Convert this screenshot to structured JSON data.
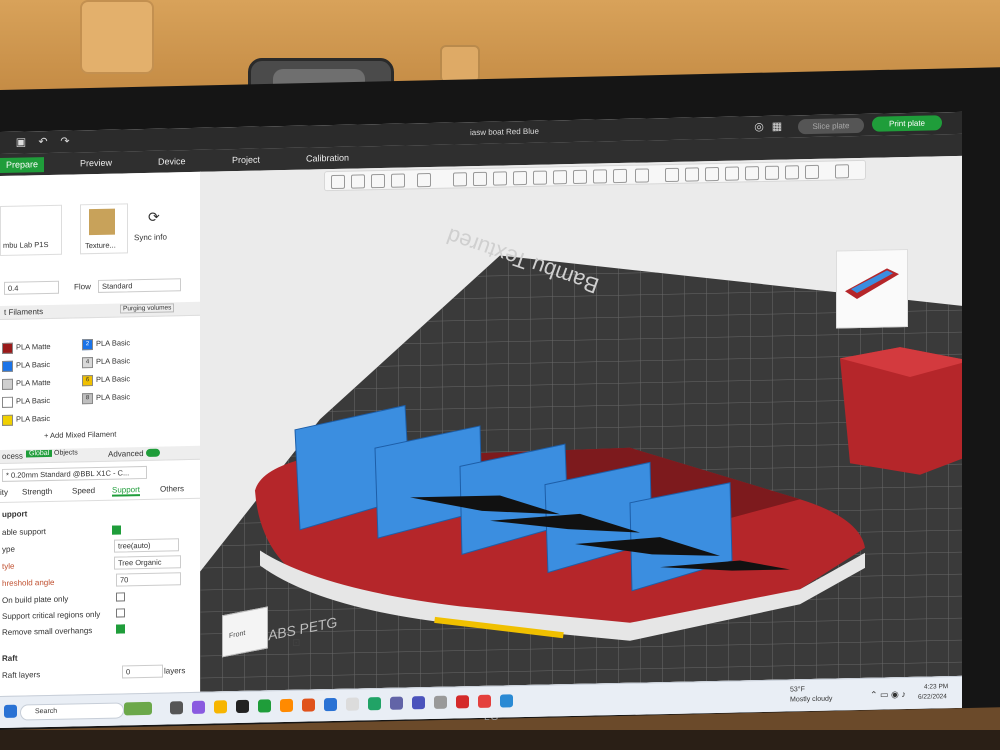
{
  "window": {
    "title": "iasw boat Red Blue",
    "slice_label": "Slice plate",
    "print_label": "Print plate"
  },
  "tabs": [
    {
      "label": "Prepare",
      "active": true
    },
    {
      "label": "Preview"
    },
    {
      "label": "Device"
    },
    {
      "label": "Project"
    },
    {
      "label": "Calibration"
    }
  ],
  "printer": {
    "name": "mbu Lab P1S",
    "plate_label": "Texture...",
    "sync_label": "Sync info",
    "nozzle": "0.4",
    "flow_label": "Flow",
    "flow_value": "Standard"
  },
  "filaments": {
    "header": "t Filaments",
    "purge_label": "Purging volumes",
    "add_mixed": "+ Add Mixed Filament",
    "left": [
      {
        "label": "PLA Matte",
        "color": "#9a1a1a"
      },
      {
        "label": "PLA Basic",
        "color": "#1a73e8"
      },
      {
        "label": "PLA Matte",
        "color": "#cfcfcf"
      },
      {
        "label": "PLA Basic",
        "color": "#ffffff"
      },
      {
        "label": "PLA Basic",
        "color": "#f0d000"
      }
    ],
    "right": [
      {
        "num": "2",
        "label": "PLA Basic",
        "color": "#1a73e8"
      },
      {
        "num": "4",
        "label": "PLA Basic",
        "color": "#d9d9d9"
      },
      {
        "num": "6",
        "label": "PLA Basic",
        "color": "#f0c000"
      },
      {
        "num": "8",
        "label": "PLA Basic",
        "color": "#bfbfbf"
      }
    ]
  },
  "process": {
    "label": "ocess",
    "global": "Global",
    "objects": "Objects",
    "advanced": "Advanced",
    "profile": "* 0.20mm Standard @BBL X1C - C...",
    "subtabs": [
      "ity",
      "Strength",
      "Speed",
      "Support",
      "Others"
    ],
    "active_subtab": "Support"
  },
  "support": {
    "section": "upport",
    "enable_label": "able support",
    "type_label": "ype",
    "type_value": "tree(auto)",
    "style_label": "tyle",
    "style_value": "Tree Organic",
    "threshold_label": "hreshold angle",
    "threshold_value": "70",
    "build_plate_only": "On build plate only",
    "critical_regions": "Support critical regions only",
    "remove_small": "Remove small overhangs",
    "raft_section": "Raft",
    "raft_layers_label": "Raft layers",
    "raft_layers_value": "0",
    "raft_units": "layers"
  },
  "viewport": {
    "plate_text": "Bambu Textured",
    "plate_text_front": "PLA ABS PETG",
    "cube_label": "Front"
  },
  "taskbar": {
    "search": "Search",
    "weather_temp": "53°F",
    "weather_desc": "Mostly cloudy",
    "time": "4:23 PM",
    "date": "6/22/2024"
  },
  "colors": {
    "accent": "#1f9d3a",
    "boat_red": "#b5262a",
    "seat_blue": "#3b8ee0",
    "plate_dark": "#3a3a3a"
  }
}
